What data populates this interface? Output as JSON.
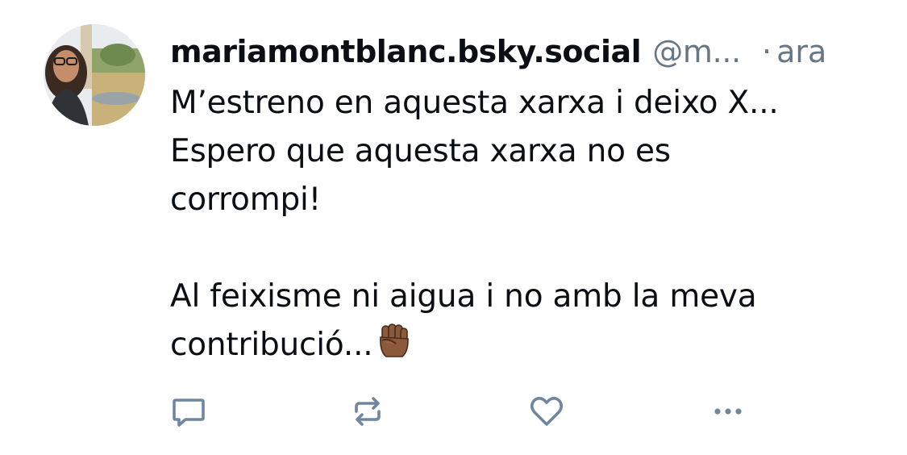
{
  "post": {
    "display_name": "mariamontblanc.bsky.social",
    "handle": "@m...",
    "separator": "·",
    "timestamp": "ara",
    "text": "M’estreno en aquesta xarxa i deixo X...\nEspero que aquesta xarxa no es\ncorrompi!\n\nAl feixisme ni aigua i no amb la meva\ncontribució...",
    "emoji": "raised-fist-medium-dark-skin-tone"
  },
  "actions": [
    {
      "name": "reply",
      "icon": "reply-icon"
    },
    {
      "name": "repost",
      "icon": "repost-icon"
    },
    {
      "name": "like",
      "icon": "heart-icon"
    },
    {
      "name": "more",
      "icon": "more-icon"
    }
  ],
  "colors": {
    "text_primary": "#0b0f14",
    "text_secondary": "#687684",
    "action_icon": "#6f869f",
    "background": "#ffffff"
  }
}
